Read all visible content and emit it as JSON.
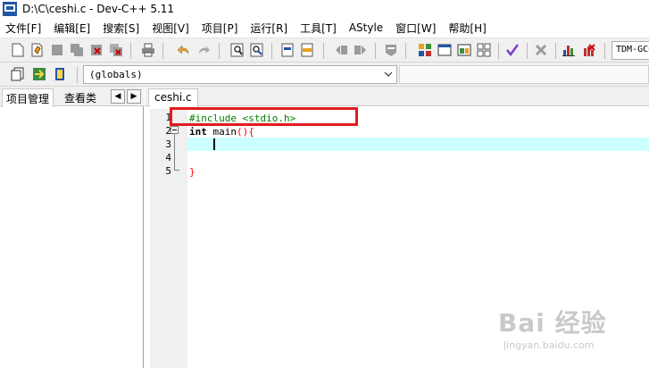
{
  "window": {
    "title": "D:\\C\\ceshi.c - Dev-C++ 5.11"
  },
  "menu": [
    "文件[F]",
    "编辑[E]",
    "搜索[S]",
    "视图[V]",
    "项目[P]",
    "运行[R]",
    "工具[T]",
    "AStyle",
    "窗口[W]",
    "帮助[H]"
  ],
  "toolbar": {
    "compiler": "TDM-GCC"
  },
  "scope_selector": {
    "value": "(globals)"
  },
  "left_panel": {
    "tabs": [
      "项目管理",
      "查看类"
    ],
    "scroll_left": "◀",
    "scroll_right": "▶"
  },
  "editor": {
    "file_tab": "ceshi.c",
    "line_numbers": [
      "1",
      "2",
      "3",
      "4",
      "5"
    ],
    "lines": {
      "l1": {
        "directive": "#include <stdio.h>"
      },
      "l2": {
        "keyword": "int",
        "name": " main",
        "paren": "()",
        "brace": "{"
      },
      "l5": {
        "brace": "}"
      }
    }
  },
  "watermark": {
    "logo": "Bai 经验",
    "url": "jingyan.baidu.com"
  },
  "colors": {
    "highlight": "#e01c1c",
    "active_line": "#ccffff",
    "directive": "#008000",
    "symbol": "#ff0000"
  }
}
